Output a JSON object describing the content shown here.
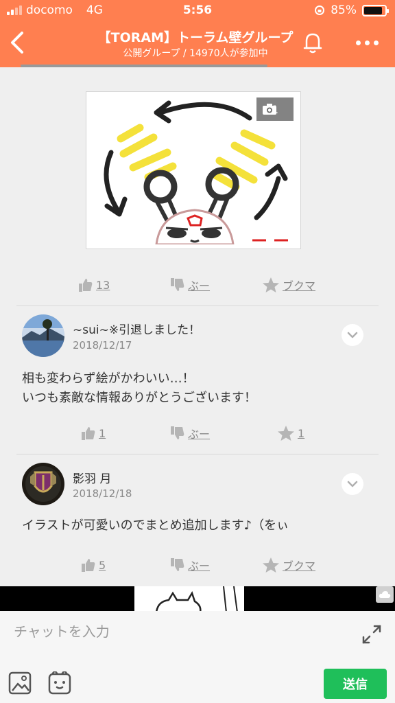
{
  "status": {
    "carrier": "docomo",
    "network": "4G",
    "time": "5:56",
    "battery": "85%",
    "battery_level": 0.85
  },
  "header": {
    "title": "【TORAM】トーラム壁グループ",
    "subtitle": "公開グループ / 14970人が参加中",
    "bg_color": "#ff7f50"
  },
  "post": {
    "photo_count": "1",
    "actions": {
      "like": "13",
      "boo": "ぶー",
      "bookmark": "ブクマ"
    }
  },
  "comments": [
    {
      "name": "~sui~※引退しました！",
      "date": "2018/12/17",
      "lines": [
        "相も変わらず絵がかわいい…！",
        "いつも素敵な情報ありがとうございます！"
      ],
      "actions": {
        "like": "1",
        "boo": "ぶー",
        "star": "1"
      }
    },
    {
      "name": "影羽 月",
      "date": "2018/12/18",
      "lines": [
        "イラストが可愛いのでまとめ追加します♪（をぃ"
      ],
      "actions": {
        "like": "5",
        "boo": "ぶー",
        "bookmark": "ブクマ"
      }
    }
  ],
  "chat": {
    "placeholder": "チャットを入力",
    "send": "送信",
    "send_color": "#1fbf5a"
  }
}
